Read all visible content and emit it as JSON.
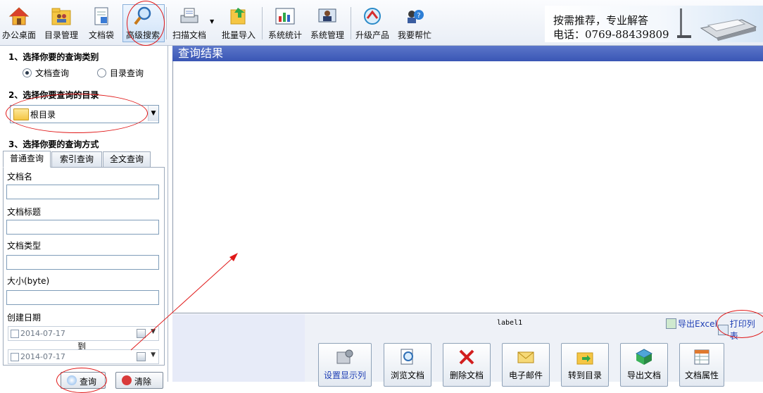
{
  "toolbar": {
    "items": [
      {
        "label": "办公桌面",
        "icon": "house-icon"
      },
      {
        "label": "目录管理",
        "icon": "folder-users-icon"
      },
      {
        "label": "文档袋",
        "icon": "document-bag-icon"
      },
      {
        "label": "高级搜索",
        "icon": "magnifier-icon"
      },
      {
        "label": "扫描文档",
        "icon": "scanner-icon"
      },
      {
        "label": "批量导入",
        "icon": "batch-import-icon"
      },
      {
        "label": "系统统计",
        "icon": "bar-chart-icon"
      },
      {
        "label": "系统管理",
        "icon": "admin-user-icon"
      },
      {
        "label": "升级产品",
        "icon": "upgrade-icon"
      },
      {
        "label": "我要帮忙",
        "icon": "help-users-icon"
      }
    ]
  },
  "banner": {
    "line1": "按需推荐，专业解答",
    "line2": "电话：0769-88439809"
  },
  "left": {
    "step1": "1、选择你要的查询类别",
    "radio1": "文档查询",
    "radio2": "目录查询",
    "radio_selected": "文档查询",
    "step2": "2、选择你要查询的目录",
    "folder": "根目录",
    "step3": "3、选择你要的查询方式",
    "tabs": [
      "普通查询",
      "索引查询",
      "全文查询"
    ],
    "fields": {
      "name": "文档名",
      "title": "文档标题",
      "type": "文档类型",
      "size": "大小(byte)",
      "created": "创建日期"
    },
    "date_from": "2014-07-17",
    "date_to_label": "到",
    "date_to": "2014-07-17",
    "search_button": "查询",
    "clear_button": "清除"
  },
  "results": {
    "title": "查询结果",
    "label": "label1",
    "export_excel": "导出Excel",
    "print_list": "打印列表"
  },
  "actions": [
    "设置显示列",
    "浏览文档",
    "删除文档",
    "电子邮件",
    "转到目录",
    "导出文档",
    "文档属性"
  ],
  "colors": {
    "accent": "#3a56b5",
    "annotation": "#e01818"
  }
}
